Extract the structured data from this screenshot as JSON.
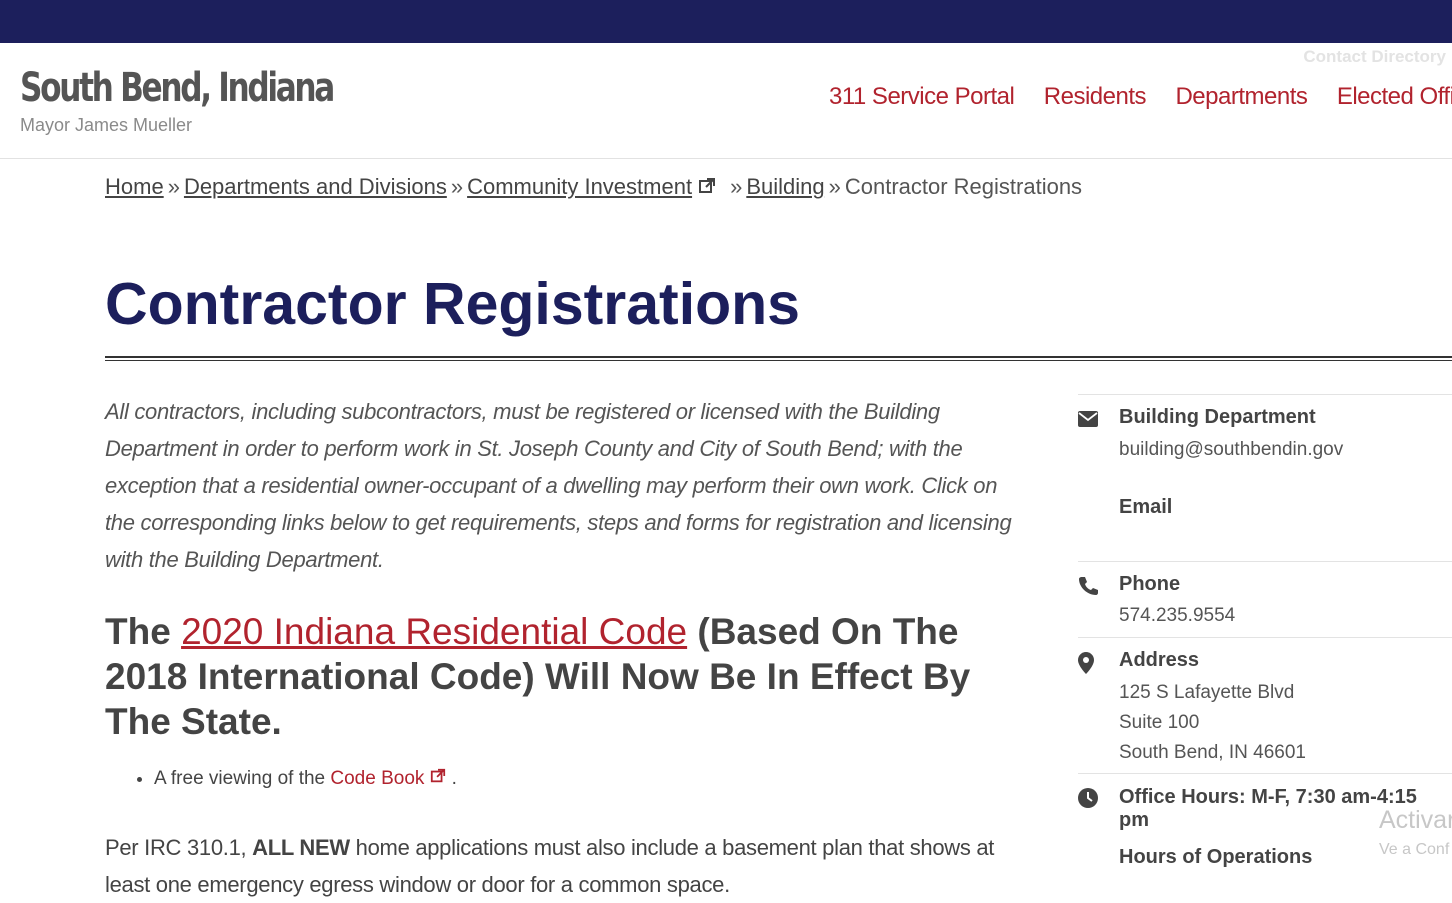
{
  "header": {
    "site_title": "South Bend, Indiana",
    "site_subtitle": "Mayor James Mueller",
    "contact_directory": "Contact Directory",
    "nav": [
      "311 Service Portal",
      "Residents",
      "Departments",
      "Elected Offic"
    ]
  },
  "breadcrumb": {
    "home": "Home",
    "departments": "Departments and Divisions",
    "community": "Community Investment",
    "building": "Building",
    "current": "Contractor Registrations",
    "separator": "»"
  },
  "page": {
    "title": "Contractor Registrations",
    "intro": "All contractors, including subcontractors, must be registered or licensed with the Building Department in order to perform work in St. Joseph County and City of South Bend; with the exception that a residential owner-occupant of a dwelling may perform their own work. Click on the corresponding links below to get requirements, steps and forms for registration and licensing with the Building Department.",
    "heading_pre": "The ",
    "heading_link": "2020 Indiana Residential Code",
    "heading_post": " (Based On The 2018 International Code) Will Now Be In Effect By The State.",
    "bullet_pre": "A free viewing of the",
    "bullet_link": " Code Book",
    "bullet_post": " .",
    "para_pre": "Per IRC 310.1, ",
    "para_bold": "ALL NEW",
    "para_post": " home applications must also include a basement plan that shows at least one emergency egress window or door for a common space."
  },
  "sidebar": {
    "dept_label": "Building Department",
    "dept_email": "building@southbendin.gov",
    "email_label": "Email",
    "phone_label": "Phone",
    "phone_value": "574.235.9554",
    "address_label": "Address",
    "address_line1": "125 S Lafayette Blvd",
    "address_line2": "Suite 100",
    "address_line3": "South Bend, IN 46601",
    "hours_label": "Office Hours: M-F, 7:30 am-4:15 pm",
    "hours_ops": "Hours of Operations"
  },
  "watermark": {
    "line1": "Activar",
    "line2": "Ve a Conf"
  },
  "colors": {
    "navy": "#1c1f5c",
    "link_red": "#b1232e"
  },
  "icons": [
    "envelope-icon",
    "phone-icon",
    "map-pin-icon",
    "clock-icon",
    "external-link-icon"
  ]
}
